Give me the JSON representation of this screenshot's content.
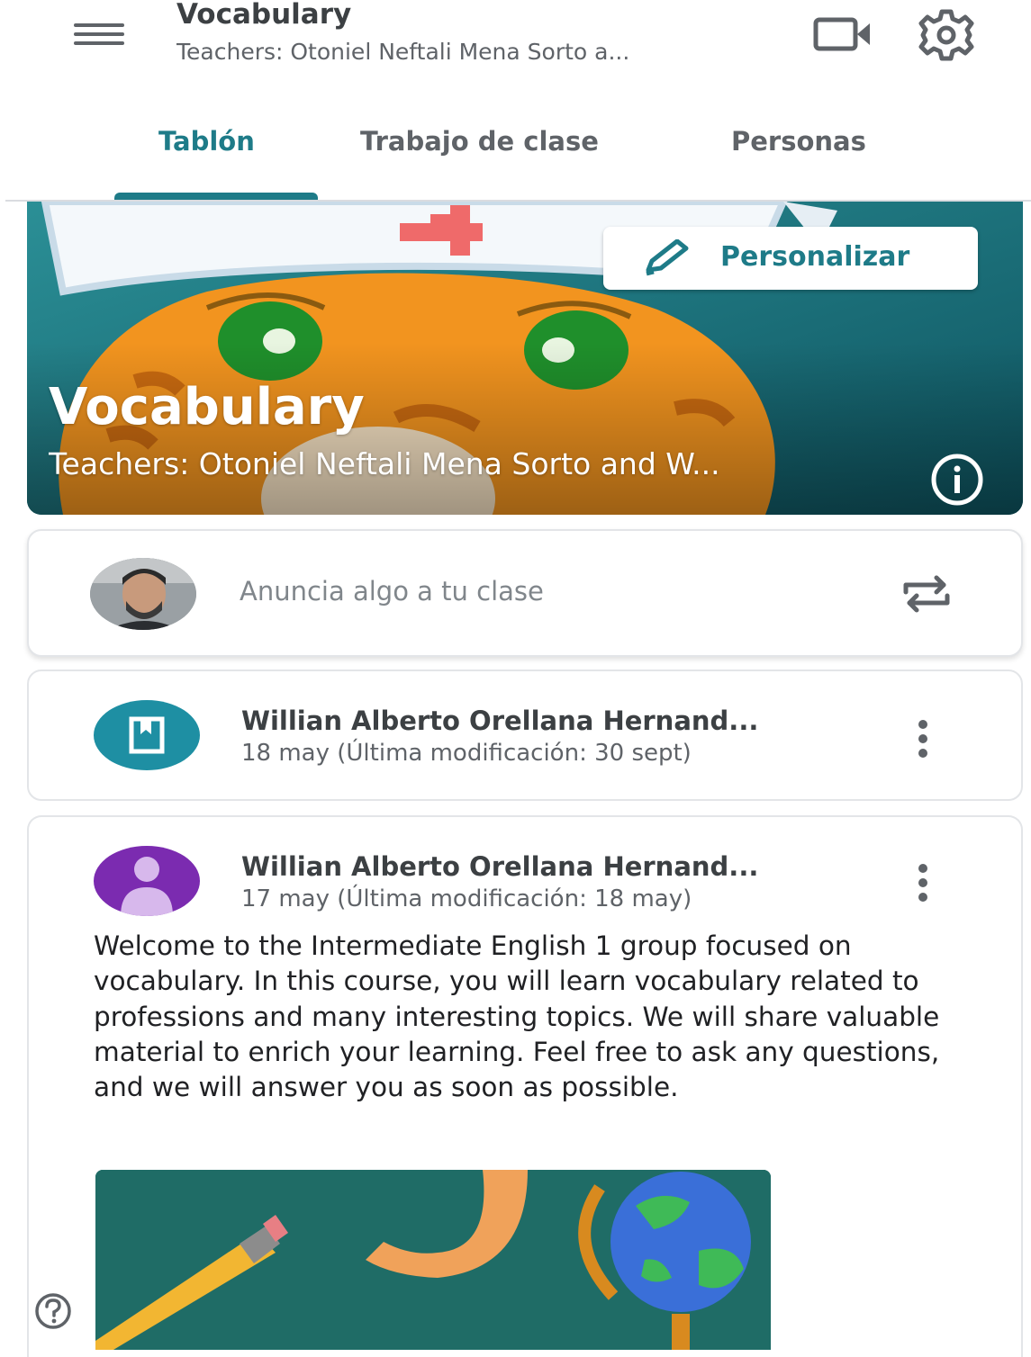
{
  "app_bar": {
    "title": "Vocabulary",
    "subtitle": "Teachers: Otoniel Neftali Mena Sorto a...",
    "icons": [
      "menu-icon",
      "video-camera-icon",
      "gear-icon"
    ]
  },
  "tabs": [
    {
      "label": "Tablón",
      "active": true
    },
    {
      "label": "Trabajo de clase",
      "active": false
    },
    {
      "label": "Personas",
      "active": false
    }
  ],
  "banner": {
    "title": "Vocabulary",
    "subtitle": "Teachers: Otoniel Neftali Mena Sorto and W...",
    "customize_label": "Personalizar",
    "icons": [
      "pencil-icon",
      "info-icon"
    ]
  },
  "share_box": {
    "placeholder": "Anuncia algo a tu clase",
    "icons": [
      "repost-icon"
    ]
  },
  "stream": [
    {
      "author": "Willian Alberto Orellana Hernand...",
      "date": "18 may (Última modificación: 30 sept)",
      "icon": "material-icon"
    },
    {
      "author": "Willian Alberto Orellana Hernand...",
      "date": "17 may (Última modificación: 18 may)",
      "icon": "avatar-placeholder-icon",
      "body": "Welcome to the Intermediate English 1 group focused on vocabulary. In this course, you will learn vocabulary related to professions and many interesting topics. We will share valuable material to enrich your learning. Feel free to ask any questions, and we will answer you as soon as possible."
    }
  ],
  "colors": {
    "accent": "#1e7b88",
    "banner_bg": "#12616d",
    "material_icon_bg": "#1e8fa3",
    "avatar_purple": "#7b2bb0"
  }
}
